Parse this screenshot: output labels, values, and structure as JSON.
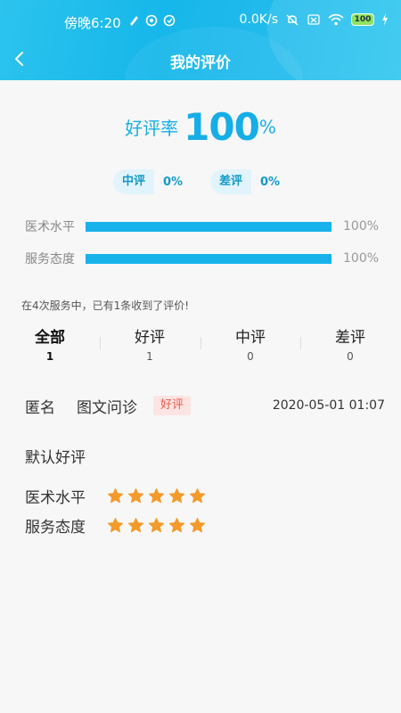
{
  "status_bar": {
    "time": "傍晚6:20",
    "speed": "0.0K/s",
    "battery": "100"
  },
  "header": {
    "title": "我的评价",
    "back_icon": "chevron-left-icon"
  },
  "summary": {
    "rate_label": "好评率",
    "rate_value": "100",
    "rate_unit": "%",
    "pills": [
      {
        "label": "中评",
        "value": "0%"
      },
      {
        "label": "差评",
        "value": "0%"
      }
    ],
    "bars": [
      {
        "label": "医术水平",
        "value_text": "100%",
        "fraction": 1.0
      },
      {
        "label": "服务态度",
        "value_text": "100%",
        "fraction": 1.0
      }
    ],
    "text": "在4次服务中，已有1条收到了评价!"
  },
  "filters": [
    {
      "label": "全部",
      "count": "1"
    },
    {
      "label": "好评",
      "count": "1"
    },
    {
      "label": "中评",
      "count": "0"
    },
    {
      "label": "差评",
      "count": "0"
    }
  ],
  "review": {
    "name": "匿名",
    "type": "图文问诊",
    "tag": "好评",
    "time": "2020-05-01 01:07",
    "text": "默认好评",
    "ratings": [
      {
        "label": "医术水平",
        "stars": 5
      },
      {
        "label": "服务态度",
        "stars": 5
      }
    ]
  },
  "colors": {
    "accent": "#16b2e9",
    "star": "#f39a2a",
    "good_tag_bg": "#fde4e2",
    "good_tag_text": "#e45a4a"
  }
}
